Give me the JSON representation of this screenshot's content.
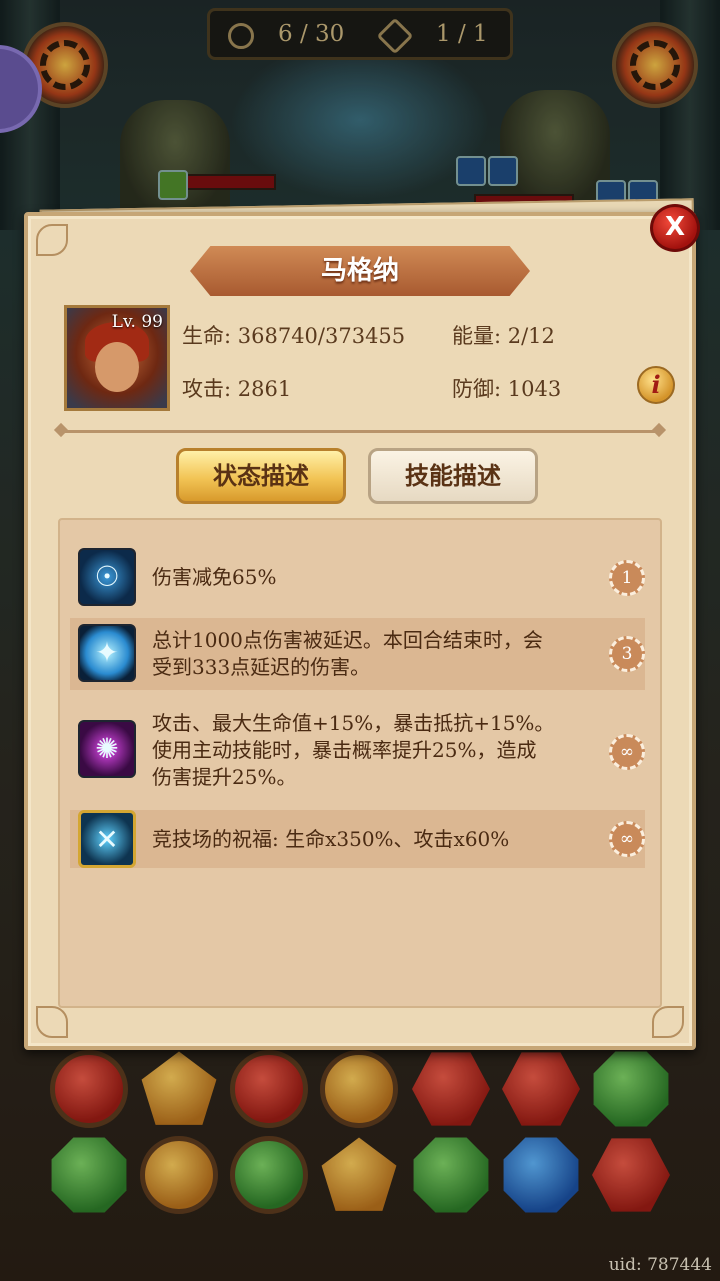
{
  "top_bar": {
    "turns": "6 / 30",
    "rounds": "1 / 1"
  },
  "hero": {
    "name": "马格纳",
    "level": "Lv. 99",
    "hp": "生命: 368740/373455",
    "energy": "能量: 2/12",
    "attack": "攻击: 2861",
    "defense": "防御: 1043"
  },
  "tabs": {
    "status": "状态描述",
    "skill": "技能描述"
  },
  "buffs": [
    {
      "line1": "伤害减免65%",
      "line2": "",
      "line3": "",
      "turns": "1",
      "icon": "shield-icon"
    },
    {
      "line1": "总计1000点伤害被延迟。本回合结束时，会",
      "line2": "受到333点延迟的伤害。",
      "line3": "",
      "turns": "3",
      "icon": "delayed-damage-icon"
    },
    {
      "line1": "攻击、最大生命值+15%，暴击抵抗+15%。",
      "line2": "使用主动技能时，暴击概率提升25%，造成",
      "line3": "伤害提升25%。",
      "turns": "∞",
      "icon": "rune-gear-icon"
    },
    {
      "line1": "竞技场的祝福: 生命x350%、攻击x60%",
      "line2": "",
      "line3": "",
      "turns": "∞",
      "icon": "crossed-swords-icon"
    }
  ],
  "close_label": "X",
  "info_label": "i",
  "footer": {
    "uid": "uid: 787444"
  },
  "colors": {
    "panel_bg": "#ecd9b6",
    "ribbon": "#b8643a",
    "active_tab": "#f2c455",
    "close_red": "#c4181a"
  }
}
